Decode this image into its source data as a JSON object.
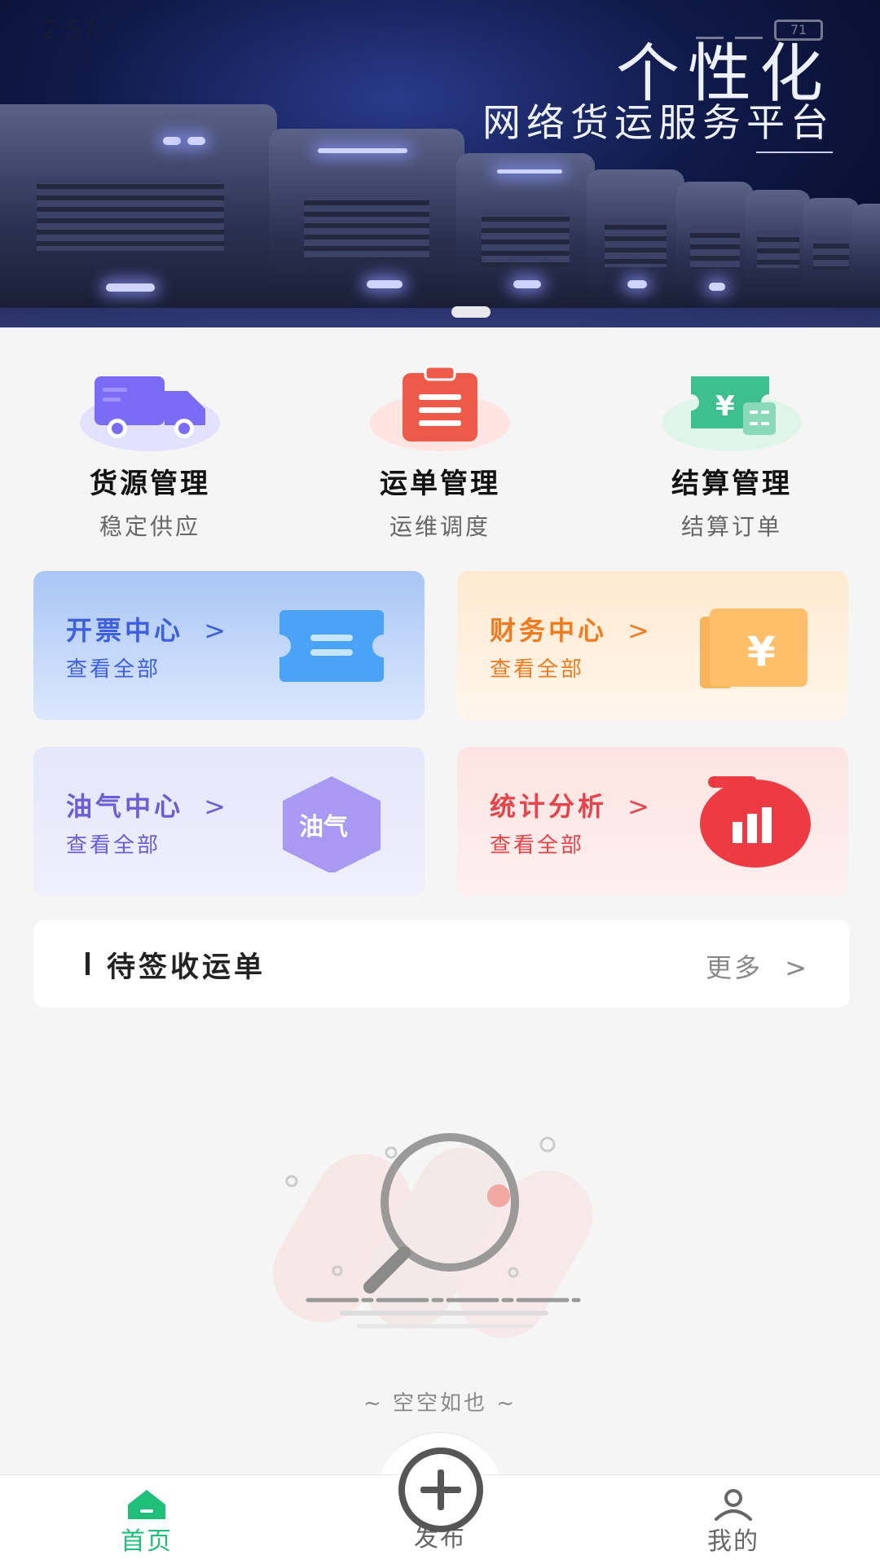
{
  "status_bar": {
    "time": "2:57",
    "battery": "71"
  },
  "banner": {
    "title": "个性化",
    "subtitle": "网络货运服务平台"
  },
  "quick_menu": [
    {
      "label": "货源管理",
      "sub": "稳定供应",
      "icon": "truck-icon",
      "color": "#7b6cf6"
    },
    {
      "label": "运单管理",
      "sub": "运维调度",
      "icon": "clipboard-icon",
      "color": "#ee5a4a"
    },
    {
      "label": "结算管理",
      "sub": "结算订单",
      "icon": "yen-ticket-icon",
      "color": "#3dbf8f"
    }
  ],
  "cards": [
    {
      "title": "开票中心",
      "sub": "查看全部",
      "arrow": ">",
      "icon": "invoice-ticket-icon",
      "color": "#3d5fe0"
    },
    {
      "title": "财务中心",
      "sub": "查看全部",
      "arrow": ">",
      "icon": "yen-wallet-icon",
      "color": "#f07a1e",
      "icon_text": "¥"
    },
    {
      "title": "油气中心",
      "sub": "查看全部",
      "arrow": ">",
      "icon": "oil-gas-hexagon-icon",
      "color": "#6a5ed8",
      "icon_text": "油气"
    },
    {
      "title": "统计分析",
      "sub": "查看全部",
      "arrow": ">",
      "icon": "bar-chart-icon",
      "color": "#e8424a"
    }
  ],
  "section": {
    "title": "待签收运单",
    "more": "更多",
    "more_arrow": ">"
  },
  "empty": {
    "text": "~ 空空如也 ~"
  },
  "bottom_nav": {
    "home": "首页",
    "publish": "发布",
    "mine": "我的",
    "active_color": "#1fbf7a",
    "inactive_color": "#666666"
  }
}
